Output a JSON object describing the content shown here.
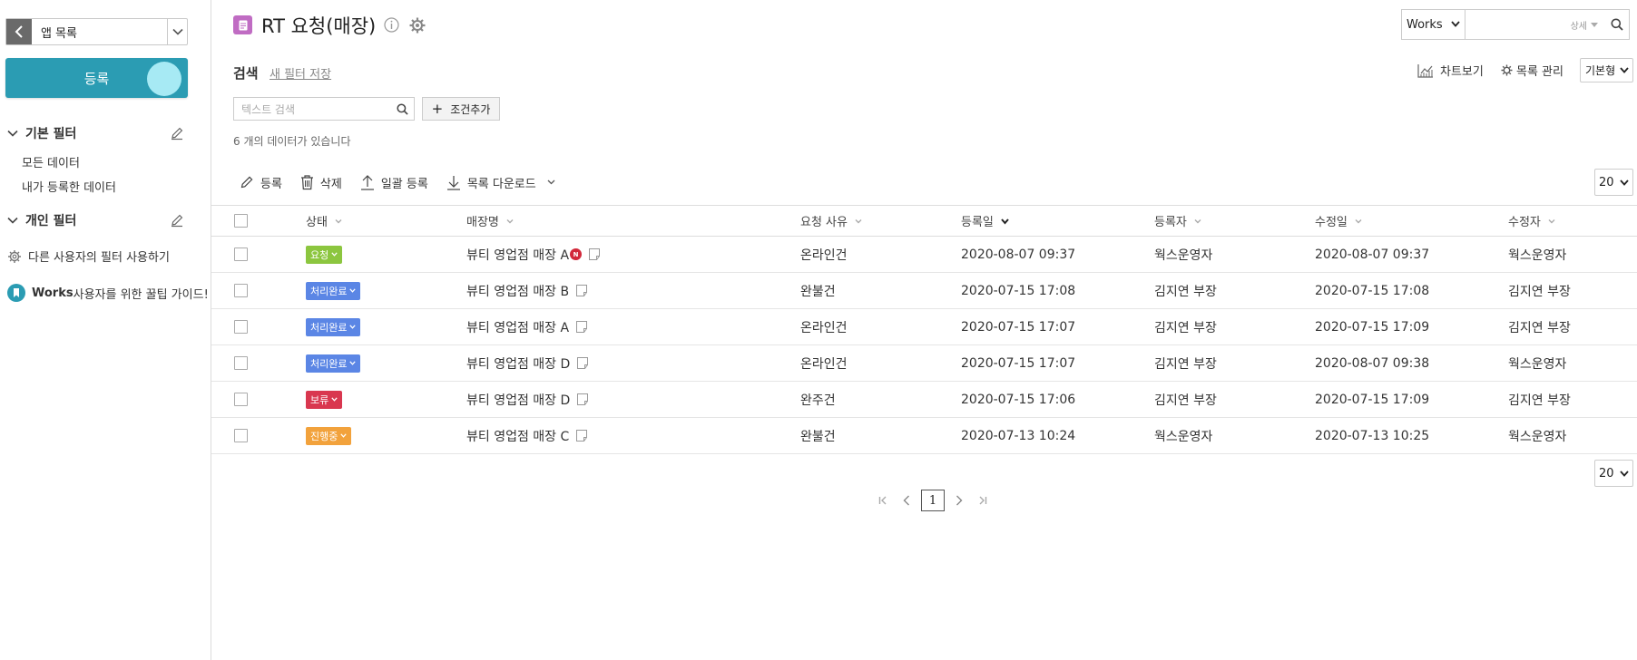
{
  "sidebar": {
    "app_list_label": "앱 목록",
    "register_label": "등록",
    "basic_filter_title": "기본 필터",
    "basic_filters": [
      "모든 데이터",
      "내가 등록한 데이터"
    ],
    "personal_filter_title": "개인 필터",
    "other_users_filter": "다른 사용자의 필터 사용하기",
    "tips_guide_bold": "Works",
    "tips_guide_rest": " 사용자를 위한 꿀팁 가이드!"
  },
  "header": {
    "title": "RT 요청(매장)",
    "search_scope": "Works",
    "search_detail": "상세"
  },
  "search": {
    "label": "검색",
    "save_new_filter": "새 필터 저장",
    "text_placeholder": "텍스트 검색",
    "add_condition": "조건추가",
    "result_count": "6 개의 데이터가 있습니다"
  },
  "view_controls": {
    "chart_view": "차트보기",
    "list_manage": "목록 관리",
    "view_type": "기본형"
  },
  "toolbar": {
    "register": "등록",
    "delete": "삭제",
    "bulk_register": "일괄 등록",
    "list_download": "목록 다운로드",
    "page_size": "20"
  },
  "table": {
    "columns": [
      "상태",
      "매장명",
      "요청 사유",
      "등록일",
      "등록자",
      "수정일",
      "수정자"
    ],
    "rows": [
      {
        "status": "요청",
        "status_color": "#8cc63f",
        "store": "뷰티 영업점 매장 A",
        "is_new": true,
        "reason": "온라인건",
        "created": "2020-08-07 09:37",
        "creator": "웍스운영자",
        "modified": "2020-08-07 09:37",
        "modifier": "웍스운영자"
      },
      {
        "status": "처리완료",
        "status_color": "#5b86e5",
        "store": "뷰티 영업점 매장 B",
        "is_new": false,
        "reason": "완불건",
        "created": "2020-07-15 17:08",
        "creator": "김지연 부장",
        "modified": "2020-07-15 17:08",
        "modifier": "김지연 부장"
      },
      {
        "status": "처리완료",
        "status_color": "#5b86e5",
        "store": "뷰티 영업점 매장 A",
        "is_new": false,
        "reason": "온라인건",
        "created": "2020-07-15 17:07",
        "creator": "김지연 부장",
        "modified": "2020-07-15 17:09",
        "modifier": "김지연 부장"
      },
      {
        "status": "처리완료",
        "status_color": "#5b86e5",
        "store": "뷰티 영업점 매장 D",
        "is_new": false,
        "reason": "온라인건",
        "created": "2020-07-15 17:07",
        "creator": "김지연 부장",
        "modified": "2020-08-07 09:38",
        "modifier": "웍스운영자"
      },
      {
        "status": "보류",
        "status_color": "#d9374f",
        "store": "뷰티 영업점 매장 D",
        "is_new": false,
        "reason": "완주건",
        "created": "2020-07-15 17:06",
        "creator": "김지연 부장",
        "modified": "2020-07-15 17:09",
        "modifier": "김지연 부장"
      },
      {
        "status": "진행중",
        "status_color": "#f2a23c",
        "store": "뷰티 영업점 매장 C",
        "is_new": false,
        "reason": "완불건",
        "created": "2020-07-13 10:24",
        "creator": "웍스운영자",
        "modified": "2020-07-13 10:25",
        "modifier": "웍스운영자"
      }
    ],
    "new_badge": "N"
  },
  "pagination": {
    "current_page": "1",
    "page_size": "20"
  },
  "colors": {
    "accent": "#2b9cb3",
    "app_icon": "#c06cc3"
  }
}
